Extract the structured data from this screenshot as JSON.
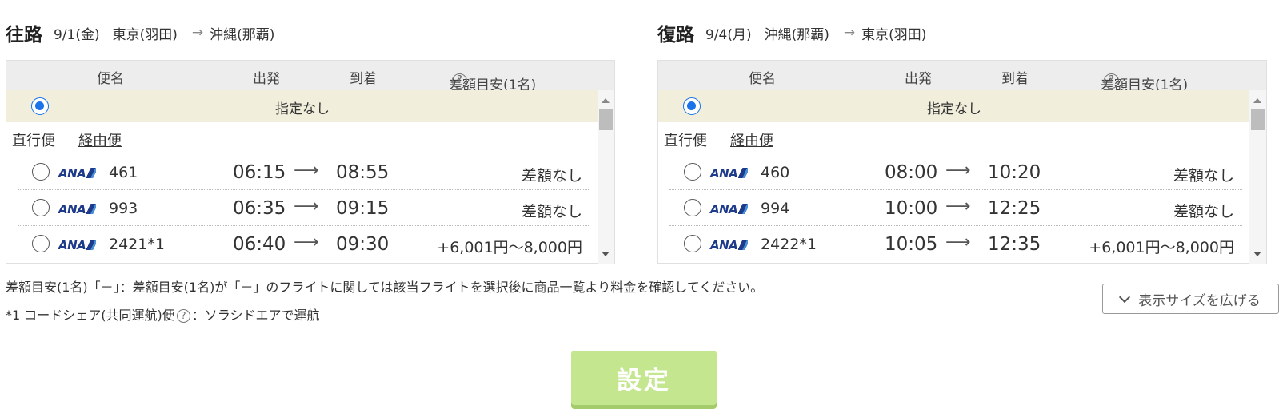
{
  "outbound": {
    "title": "往路",
    "date": "9/1(金)",
    "from": "東京(羽田)",
    "arrow": "→",
    "to": "沖縄(那覇)",
    "headers": {
      "flight": "便名",
      "departure": "出発",
      "arrival": "到着",
      "diff": "差額目安(1名)"
    },
    "none_label": "指定なし",
    "tab_direct": "直行便",
    "tab_via": "経由便",
    "flights": [
      {
        "airline": "ANA",
        "number": "461",
        "dep": "06:15",
        "arr": "08:55",
        "diff": "差額なし"
      },
      {
        "airline": "ANA",
        "number": "993",
        "dep": "06:35",
        "arr": "09:15",
        "diff": "差額なし"
      },
      {
        "airline": "ANA",
        "number": "2421*1",
        "dep": "06:40",
        "arr": "09:30",
        "diff": "+6,001円～8,000円"
      }
    ]
  },
  "return": {
    "title": "復路",
    "date": "9/4(月)",
    "from": "沖縄(那覇)",
    "arrow": "→",
    "to": "東京(羽田)",
    "headers": {
      "flight": "便名",
      "departure": "出発",
      "arrival": "到着",
      "diff": "差額目安(1名)"
    },
    "none_label": "指定なし",
    "tab_direct": "直行便",
    "tab_via": "経由便",
    "flights": [
      {
        "airline": "ANA",
        "number": "460",
        "dep": "08:00",
        "arr": "10:20",
        "diff": "差額なし"
      },
      {
        "airline": "ANA",
        "number": "994",
        "dep": "10:00",
        "arr": "12:25",
        "diff": "差額なし"
      },
      {
        "airline": "ANA",
        "number": "2422*1",
        "dep": "10:05",
        "arr": "12:35",
        "diff": "+6,001円～8,000円"
      }
    ]
  },
  "time_arrow": "⟶",
  "help_mark": "?",
  "notes": {
    "diff_note": "差額目安(1名)「－」：差額目安(1名)が「－」のフライトに関しては該当フライトを選択後に商品一覧より料金を確認してください。",
    "codeshare_prefix": "*1 コードシェア(共同運航)便",
    "codeshare_suffix": "：ソラシドエアで運航"
  },
  "expand_button": "表示サイズを広げる",
  "submit_button": "設定",
  "colors": {
    "selected_row_bg": "#f1eedb",
    "header_bg": "#ededed",
    "radio_selected": "#1a73e8",
    "submit_bg": "#c3e68e",
    "ana_blue": "#1e3a8a"
  }
}
